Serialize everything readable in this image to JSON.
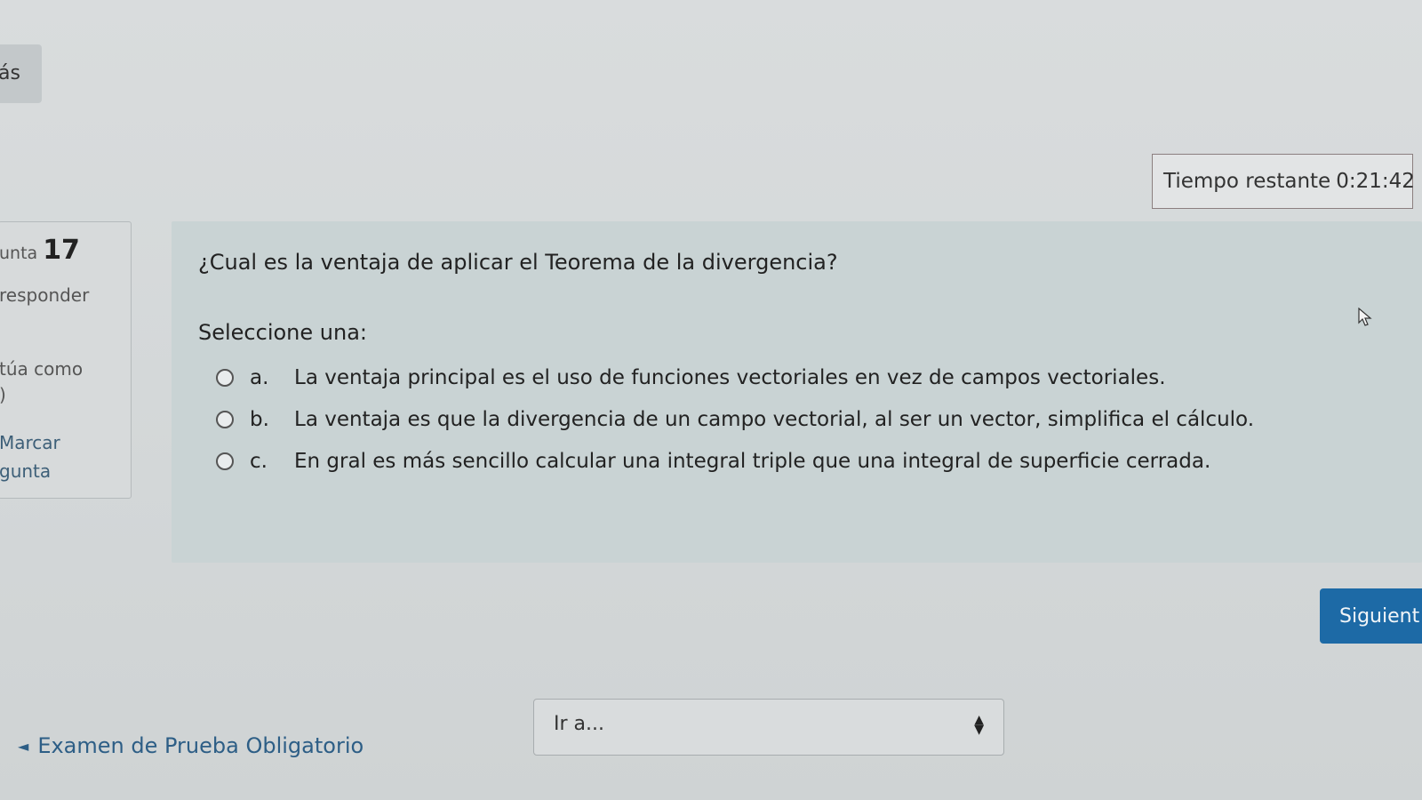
{
  "nav": {
    "more_label": "ás"
  },
  "timer": {
    "label": "Tiempo restante",
    "value": "0:21:42"
  },
  "question_info": {
    "prefix": "unta",
    "number": "17",
    "state": "responder",
    "grade_line1": "túa como",
    "grade_line2": ")",
    "flag_line1": "Marcar",
    "flag_line2": "gunta"
  },
  "question": {
    "text": "¿Cual es la ventaja de aplicar el Teorema de la divergencia?",
    "prompt": "Seleccione una:",
    "answers": [
      {
        "letter": "a.",
        "text": "La ventaja principal es el uso de funciones vectoriales en vez de campos vectoriales."
      },
      {
        "letter": "b.",
        "text": "La ventaja es que la divergencia de un campo vectorial, al ser un vector, simplifica el cálculo."
      },
      {
        "letter": "c.",
        "text": "En gral es más sencillo calcular una integral triple que una integral de superficie cerrada."
      }
    ]
  },
  "buttons": {
    "next_label": "Siguient"
  },
  "footer": {
    "prev_link": "Examen de Prueba Obligatorio",
    "jump_placeholder": "Ir a..."
  },
  "colors": {
    "accent": "#1d6aa6",
    "link": "#2d5e86",
    "formulation_bg": "#c9d3d4"
  }
}
